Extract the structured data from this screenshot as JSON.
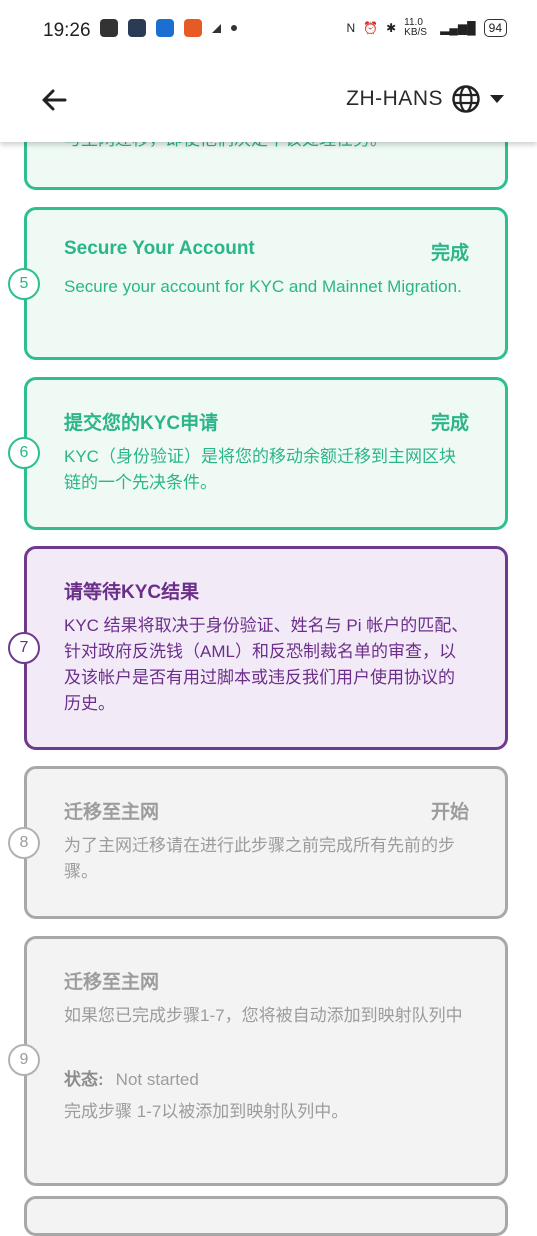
{
  "status_bar": {
    "time": "19:26",
    "network_speed": "11.0 KB/S",
    "battery": "94"
  },
  "header": {
    "language": "ZH-HANS"
  },
  "partial_top_text": "与主网迁移，即使他们决定不该处理任务。",
  "steps": [
    {
      "number": "5",
      "title": "Secure Your Account",
      "status": "完成",
      "description": "Secure your account for KYC and Mainnet Migration.",
      "state": "done"
    },
    {
      "number": "6",
      "title": "提交您的KYC申请",
      "status": "完成",
      "description": "KYC（身份验证）是将您的移动余额迁移到主网区块链的一个先决条件。",
      "state": "done"
    },
    {
      "number": "7",
      "title": "请等待KYC结果",
      "status": "",
      "description": "KYC 结果将取决于身份验证、姓名与 Pi 帐户的匹配、针对政府反洗钱（AML）和反恐制裁名单的审查，以及该帐户是否有用过脚本或违反我们用户使用协议的历史。",
      "state": "active"
    },
    {
      "number": "8",
      "title": "迁移至主网",
      "status": "开始",
      "description": "为了主网迁移请在进行此步骤之前完成所有先前的步骤。",
      "state": "pending"
    },
    {
      "number": "9",
      "title": "迁移至主网",
      "status": "",
      "description": "如果您已完成步骤1-7，您将被自动添加到映射队列中",
      "status_label": "状态:",
      "status_value": "Not started",
      "note": "完成步骤 1-7以被添加到映射队列中。",
      "state": "pending"
    }
  ]
}
